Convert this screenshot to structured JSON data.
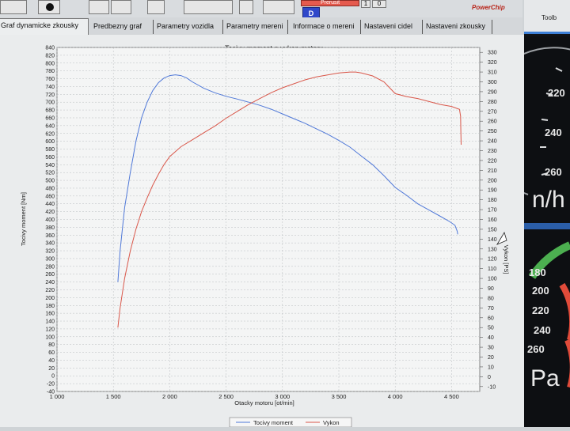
{
  "app": {
    "toolbar": {
      "red_button_label": "Prerusit",
      "value_label": "1",
      "value_field": "0",
      "mode_button_label": "D",
      "logo_text": "PowerChip"
    },
    "tabs": [
      {
        "label": "Graf dynamicke zkousky",
        "active": true
      },
      {
        "label": "Predbezny graf",
        "active": false
      },
      {
        "label": "Parametry vozidla",
        "active": false
      },
      {
        "label": "Parametry mereni",
        "active": false
      },
      {
        "label": "Informace o mereni",
        "active": false
      },
      {
        "label": "Nastaveni cidel",
        "active": false
      },
      {
        "label": "Nastaveni zkousky",
        "active": false
      }
    ],
    "side_panel": {
      "label": "Toolb",
      "upper_gauge_values": [
        "220",
        "240",
        "260"
      ],
      "upper_gauge_partial": "n/h",
      "lower_gauge_values": [
        "180",
        "200",
        "220",
        "240",
        "260"
      ],
      "lower_gauge_partial": "Pa"
    }
  },
  "chart_data": {
    "type": "line",
    "title": "Tocivy moment a vykon motoru",
    "xlabel": "Otacky motoru [ot/min]",
    "ylabel": "Tocivy moment [Nm]",
    "y2label": "Vykon [PS]",
    "xlim": [
      1000,
      4750
    ],
    "ylim": [
      -40,
      840
    ],
    "y2lim": [
      -15,
      335
    ],
    "x_ticks": [
      1000,
      1500,
      2000,
      2500,
      3000,
      3500,
      4000,
      4500
    ],
    "x_tick_labels": [
      "1 000",
      "1 500",
      "2 000",
      "2 500",
      "3 000",
      "3 500",
      "4 000",
      "4 500"
    ],
    "y_ticks": [
      -40,
      -20,
      0,
      20,
      40,
      60,
      80,
      100,
      120,
      140,
      160,
      180,
      200,
      220,
      240,
      260,
      280,
      300,
      320,
      340,
      360,
      380,
      400,
      420,
      440,
      460,
      480,
      500,
      520,
      540,
      560,
      580,
      600,
      620,
      640,
      660,
      680,
      700,
      720,
      740,
      760,
      780,
      800,
      820,
      840
    ],
    "y2_ticks": [
      -10,
      0,
      10,
      20,
      30,
      40,
      50,
      60,
      70,
      80,
      90,
      100,
      110,
      120,
      130,
      140,
      150,
      160,
      170,
      180,
      190,
      200,
      210,
      220,
      230,
      240,
      250,
      260,
      270,
      280,
      290,
      300,
      310,
      320,
      330
    ],
    "grid": true,
    "legend_placement": "bottom",
    "series": [
      {
        "name": "Tocivy moment",
        "axis": "left",
        "color": "#4f78d8",
        "x": [
          1540,
          1560,
          1600,
          1650,
          1700,
          1750,
          1800,
          1850,
          1900,
          1950,
          2000,
          2050,
          2100,
          2150,
          2200,
          2300,
          2400,
          2500,
          2600,
          2700,
          2800,
          2900,
          3000,
          3100,
          3200,
          3300,
          3400,
          3500,
          3600,
          3700,
          3800,
          3900,
          4000,
          4100,
          4200,
          4300,
          4400,
          4480,
          4530,
          4550,
          4555
        ],
        "y": [
          240,
          320,
          430,
          520,
          600,
          660,
          700,
          730,
          750,
          762,
          768,
          770,
          768,
          762,
          752,
          736,
          724,
          715,
          708,
          700,
          692,
          682,
          670,
          658,
          646,
          632,
          618,
          602,
          585,
          562,
          540,
          512,
          482,
          462,
          440,
          424,
          408,
          395,
          385,
          370,
          362
        ]
      },
      {
        "name": "Vykon",
        "axis": "right",
        "color": "#d9574a",
        "x": [
          1540,
          1560,
          1600,
          1650,
          1700,
          1750,
          1800,
          1850,
          1900,
          1950,
          2000,
          2100,
          2200,
          2300,
          2400,
          2500,
          2600,
          2700,
          2800,
          2900,
          3000,
          3100,
          3200,
          3300,
          3400,
          3500,
          3600,
          3650,
          3700,
          3800,
          3900,
          4000,
          4100,
          4200,
          4300,
          4400,
          4500,
          4570,
          4580,
          4582,
          4585
        ],
        "y": [
          50,
          70,
          100,
          128,
          150,
          168,
          182,
          195,
          206,
          216,
          224,
          234,
          241,
          248,
          255,
          263,
          270,
          277,
          283,
          289,
          294,
          298,
          302,
          305,
          307,
          309,
          310,
          310,
          309,
          306,
          300,
          288,
          285,
          283,
          280,
          277,
          275,
          272,
          265,
          250,
          236
        ]
      }
    ]
  }
}
